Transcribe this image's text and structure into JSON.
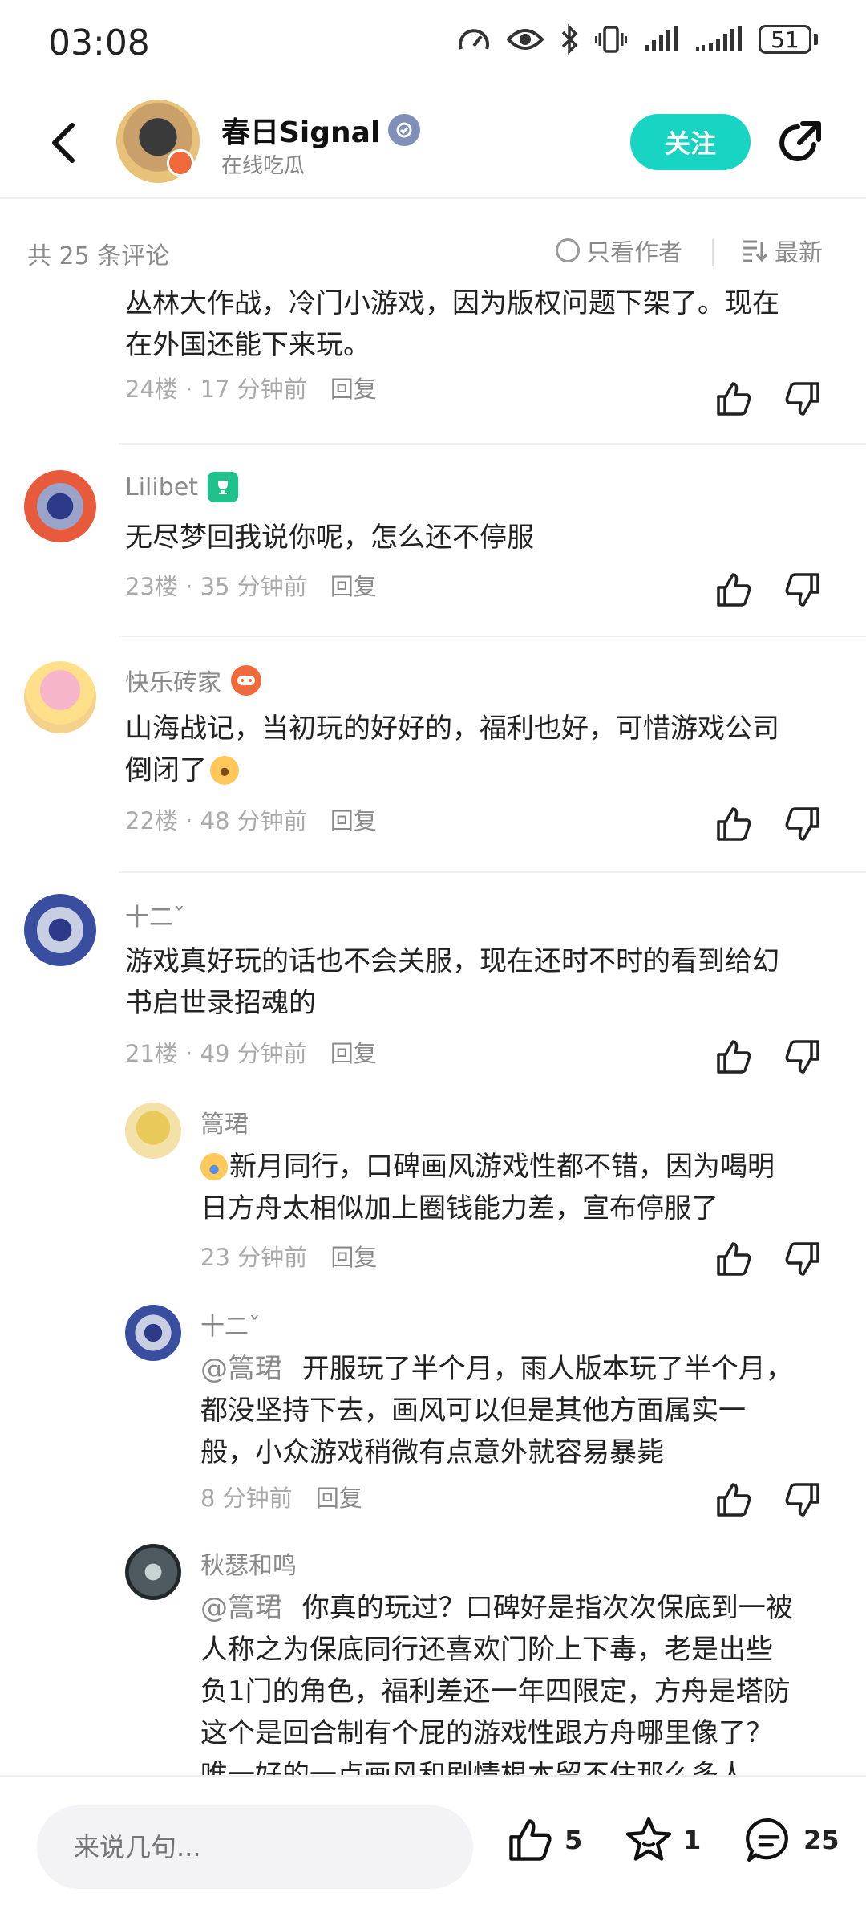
{
  "status_bar": {
    "time": "03:08",
    "battery": "51"
  },
  "header": {
    "name": "春日Signal",
    "subtitle": "在线吃瓜",
    "follow_label": "关注"
  },
  "filter": {
    "count": "共 25 条评论",
    "only_author": "只看作者",
    "sort": "最新"
  },
  "comments": [
    {
      "text_l1": "丛林大作战，冷门小游戏，因为版权问题下架了。现在",
      "text_l2": "在外国还能下来玩。",
      "floor": "24楼",
      "time": "17 分钟前",
      "reply": "回复"
    },
    {
      "user": "Lilibet",
      "text_l1": "无尽梦回我说你呢，怎么还不停服",
      "floor": "23楼",
      "time": "35 分钟前",
      "reply": "回复"
    },
    {
      "user": "快乐砖家",
      "text_l1": "山海战记，当初玩的好好的，福利也好，可惜游戏公司",
      "text_l2": "倒闭了",
      "floor": "22楼",
      "time": "48 分钟前",
      "reply": "回复"
    },
    {
      "user": "十二ˇ",
      "text_l1": "游戏真好玩的话也不会关服，现在还时不时的看到给幻",
      "text_l2": "书启世录招魂的",
      "floor": "21楼",
      "time": "49 分钟前",
      "reply": "回复"
    }
  ],
  "replies": [
    {
      "user": "篙珺",
      "text_l1": "新月同行，口碑画风游戏性都不错，因为喝明",
      "text_l2": "日方舟太相似加上圈钱能力差，宣布停服了",
      "time": "23 分钟前",
      "reply": "回复"
    },
    {
      "user": "十二ˇ",
      "at": "@篙珺",
      "text_l1": "开服玩了半个月，雨人版本玩了半个月，",
      "text_l2": "都没坚持下去，画风可以但是其他方面属实一",
      "text_l3": "般，小众游戏稍微有点意外就容易暴毙",
      "time": "8 分钟前",
      "reply": "回复"
    },
    {
      "user": "秋瑟和鸣",
      "at": "@篙珺",
      "text_l1": "你真的玩过？口碑好是指次次保底到一被",
      "text_l2": "人称之为保底同行还喜欢门阶上下毒，老是出些",
      "text_l3": "负1门的角色，福利差还一年四限定，方舟是塔防",
      "text_l4": "这个是回合制有个屁的游戏性跟方舟哪里像了？",
      "text_l5": "唯一好的一点画风和剧情根本留不住那么多人"
    }
  ],
  "bottom": {
    "input_placeholder": "来说几句...",
    "likes": "5",
    "favorites": "1",
    "comments": "25"
  },
  "colors": {
    "accent": "#18d5c3",
    "muted": "#8a8a8a"
  }
}
